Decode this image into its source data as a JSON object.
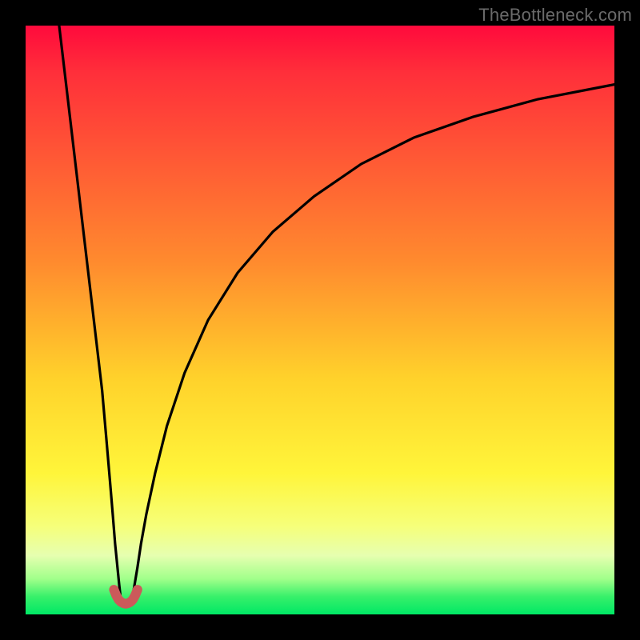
{
  "watermark": "TheBottleneck.com",
  "chart_data": {
    "type": "line",
    "title": "",
    "xlabel": "",
    "ylabel": "",
    "xlim": [
      0,
      100
    ],
    "ylim": [
      0,
      100
    ],
    "legend": false,
    "grid": false,
    "background_gradient_stops": [
      {
        "pos": 0,
        "color": "#ff0a3c"
      },
      {
        "pos": 22,
        "color": "#ff5735"
      },
      {
        "pos": 40,
        "color": "#ff8a2e"
      },
      {
        "pos": 60,
        "color": "#ffd22b"
      },
      {
        "pos": 76,
        "color": "#fff53a"
      },
      {
        "pos": 90,
        "color": "#e6ffb0"
      },
      {
        "pos": 100,
        "color": "#00e865"
      }
    ],
    "series": [
      {
        "name": "left-branch",
        "stroke": "#000000",
        "x": [
          5.7,
          7,
          8,
          9,
          10,
          11,
          12,
          13,
          13.7,
          14.3,
          14.8,
          15.2,
          15.6,
          15.9,
          16.1
        ],
        "y": [
          100,
          89,
          80.5,
          72,
          63.5,
          55,
          46.5,
          38,
          30,
          23,
          17,
          12,
          8,
          5,
          3.2
        ]
      },
      {
        "name": "right-branch",
        "stroke": "#000000",
        "x": [
          18.2,
          18.5,
          19,
          19.6,
          20.5,
          22,
          24,
          27,
          31,
          36,
          42,
          49,
          57,
          66,
          76,
          87,
          100
        ],
        "y": [
          3.2,
          5,
          8,
          12,
          17,
          24,
          32,
          41,
          50,
          58,
          65,
          71,
          76.5,
          81,
          84.5,
          87.5,
          90
        ]
      },
      {
        "name": "dip-marker",
        "stroke": "#cc5a5a",
        "x": [
          15.0,
          15.4,
          15.8,
          16.2,
          16.6,
          17.0,
          17.4,
          17.8,
          18.2,
          18.6,
          19.0
        ],
        "y": [
          4.2,
          3.2,
          2.5,
          2.1,
          1.9,
          1.8,
          1.9,
          2.1,
          2.5,
          3.2,
          4.2
        ]
      }
    ]
  }
}
